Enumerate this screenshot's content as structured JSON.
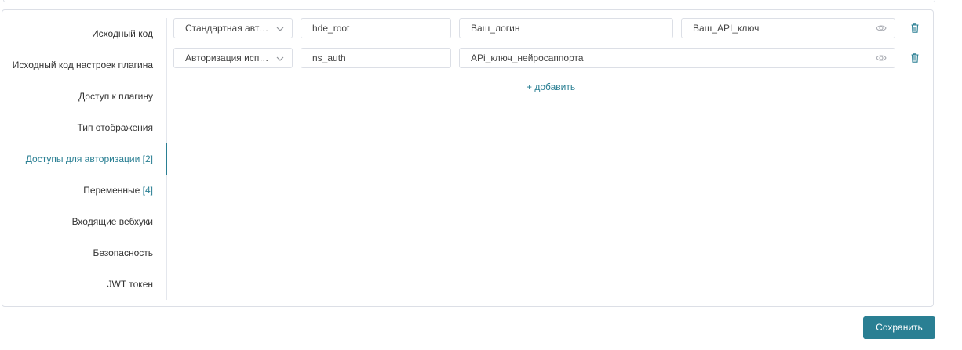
{
  "sidebar": {
    "items": [
      {
        "label": "Исходный код",
        "count": ""
      },
      {
        "label": "Исходный код настроек плагина",
        "count": ""
      },
      {
        "label": "Доступ к плагину",
        "count": ""
      },
      {
        "label": "Тип отображения",
        "count": ""
      },
      {
        "label": "Доступы для авторизации",
        "count": "[2]"
      },
      {
        "label": "Переменные",
        "count": "[4]"
      },
      {
        "label": "Входящие вебхуки",
        "count": ""
      },
      {
        "label": "Безопасность",
        "count": ""
      },
      {
        "label": "JWT токен",
        "count": ""
      }
    ],
    "active_index": 4
  },
  "auth_rows": [
    {
      "type_selected": "Стандартная авторизация",
      "name_value": "hde_root",
      "login_placeholder": "Ваш_логин",
      "secret_placeholder": "Ваш_API_ключ"
    },
    {
      "type_selected": "Авторизация используя",
      "name_value": "ns_auth",
      "secret_placeholder": "APi_ключ_нейросаппорта"
    }
  ],
  "add_label": "+ добавить",
  "save_label": "Сохранить",
  "icons": {
    "dropdown": "chevron-down-icon",
    "visibility": "eye-icon",
    "delete": "trash-icon"
  },
  "colors": {
    "accent": "#2a7f93",
    "border": "#dcdfe6",
    "text": "#333333"
  }
}
